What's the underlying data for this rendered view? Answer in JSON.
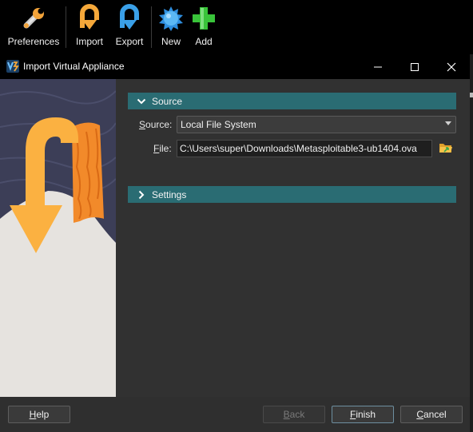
{
  "toolbar": {
    "items": [
      {
        "label": "Preferences",
        "icon": "wrench-icon"
      },
      {
        "label": "Import",
        "icon": "import-arrow-icon"
      },
      {
        "label": "Export",
        "icon": "export-arrow-icon"
      },
      {
        "label": "New",
        "icon": "new-star-icon"
      },
      {
        "label": "Add",
        "icon": "add-plus-icon"
      }
    ]
  },
  "dialog": {
    "title": "Import Virtual Appliance",
    "window_controls": [
      "minimize-icon",
      "maximize-icon",
      "close-icon"
    ]
  },
  "source_section": {
    "header": "Source",
    "expanded": true,
    "source_label_mnemonic": "S",
    "source_label_rest": "ource:",
    "source_value": "Local File System",
    "file_label_mnemonic": "F",
    "file_label_rest": "ile:",
    "file_value": "C:\\Users\\super\\Downloads\\Metasploitable3-ub1404.ova"
  },
  "settings_section": {
    "header": "Settings",
    "expanded": false
  },
  "buttons": {
    "help_mnemonic": "H",
    "help_rest": "elp",
    "back_mnemonic": "B",
    "back_rest": "ack",
    "finish_mnemonic": "F",
    "finish_rest": "inish",
    "cancel_mnemonic": "C",
    "cancel_rest": "ancel"
  },
  "colors": {
    "section_header": "#2a6c73",
    "toolbar_bg": "#000000",
    "dialog_bg": "#313131",
    "accent_orange": "#f5a83a",
    "accent_blue": "#3aa0e8",
    "accent_green": "#39c43a"
  }
}
